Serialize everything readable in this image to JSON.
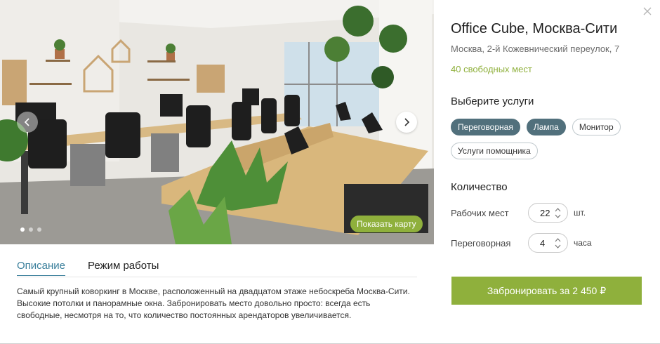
{
  "gallery": {
    "prev_label": "Previous photo",
    "next_label": "Next photo",
    "map_button": "Показать карту",
    "dots": 3,
    "active_dot": 0
  },
  "tabs": [
    {
      "label": "Описание",
      "active": true
    },
    {
      "label": "Режим работы",
      "active": false
    }
  ],
  "description": "Самый крупный коворкинг в Москве, расположенный на двадцатом этаже небоскреба Москва-Сити. Высокие потолки и панорамные окна. Забронировать место довольно просто: всегда есть свободные, несмотря на то, что количество постоянных арендаторов увеличивается.",
  "venue": {
    "title": "Office Cube, Москва-Сити",
    "address": "Москва, 2-й Кожевнический переулок, 7",
    "free_places": "40 свободных мест"
  },
  "services": {
    "title": "Выберите услуги",
    "items": [
      {
        "label": "Переговорная",
        "selected": true
      },
      {
        "label": "Лампа",
        "selected": true
      },
      {
        "label": "Монитор",
        "selected": false
      },
      {
        "label": "Услуги помощника",
        "selected": false
      }
    ]
  },
  "quantity": {
    "title": "Количество",
    "rows": [
      {
        "label": "Рабочих мест",
        "value": "22",
        "unit": "шт."
      },
      {
        "label": "Переговорная",
        "value": "4",
        "unit": "часа"
      }
    ]
  },
  "book_button": "Забронировать за 2 450 ₽",
  "colors": {
    "accent_green": "#8fb03c",
    "chip_selected": "#51707c",
    "tab_active": "#3a7f9b"
  },
  "icons": {
    "close": "close-icon",
    "prev": "chevron-left-icon",
    "next": "chevron-right-icon",
    "stepper": "stepper-arrows-icon"
  }
}
